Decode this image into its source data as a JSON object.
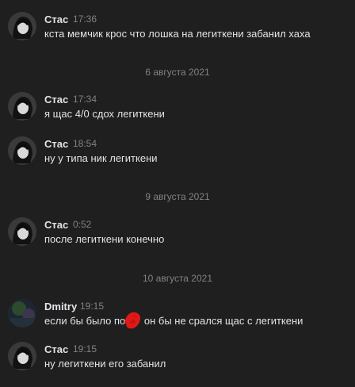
{
  "colors": {
    "background": "#1f1f20",
    "text": "#e1e3e6",
    "secondary": "#828282",
    "scribble": "#e01818"
  },
  "messages": [
    {
      "author": "Стас",
      "time": "17:36",
      "text": "кста мемчик крос что лошка на легиткени забанил хаха"
    },
    {
      "author": "Стас",
      "time": "17:34",
      "text": "я щас 4/0 сдох легиткени"
    },
    {
      "author": "Стас",
      "time": "18:54",
      "text": "ну у типа ник легиткени"
    },
    {
      "author": "Стас",
      "time": "0:52",
      "text": "после легиткени конечно"
    },
    {
      "author": "Dmitry",
      "time": "19:15",
      "text_before": "если бы было по",
      "text_after": " он бы не срался щас с легиткени"
    },
    {
      "author": "Стас",
      "time": "19:15",
      "text": "ну легиткени его забанил"
    }
  ],
  "dates": [
    "6 августа 2021",
    "9 августа 2021",
    "10 августа 2021"
  ]
}
